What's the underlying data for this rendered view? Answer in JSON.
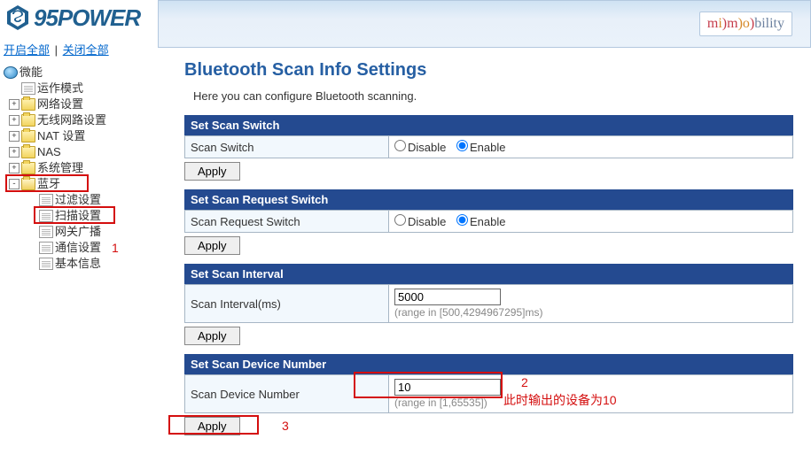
{
  "brand": {
    "name": "95POWER",
    "mimo_m": "m",
    "mimo_i": "i",
    "mimo_paren": ")",
    "mimo_m2": "m",
    "mimo_paren2": ")",
    "mimo_o": "o",
    "mimo_paren3": ")",
    "mimo_tail": "bility"
  },
  "links": {
    "open_all": "开启全部",
    "close_all": "关闭全部"
  },
  "tree": {
    "root": "微能",
    "items": [
      "运作模式",
      "网络设置",
      "无线网路设置",
      "NAT 设置",
      "NAS",
      "系统管理"
    ],
    "bt": "蓝牙",
    "bt_children": [
      "过滤设置",
      "扫描设置",
      "网关广播",
      "通信设置",
      "基本信息"
    ]
  },
  "page": {
    "title": "Bluetooth Scan Info Settings",
    "desc": "Here you can configure Bluetooth scanning."
  },
  "sections": {
    "s1": {
      "head": "Set Scan Switch",
      "label": "Scan Switch",
      "opt_disable": "Disable",
      "opt_enable": "Enable",
      "apply": "Apply"
    },
    "s2": {
      "head": "Set Scan Request Switch",
      "label": "Scan Request Switch",
      "opt_disable": "Disable",
      "opt_enable": "Enable",
      "apply": "Apply"
    },
    "s3": {
      "head": "Set Scan Interval",
      "label": "Scan Interval(ms)",
      "value": "5000",
      "hint": "(range in [500,4294967295]ms)",
      "apply": "Apply"
    },
    "s4": {
      "head": "Set Scan Device Number",
      "label": "Scan Device Number",
      "value": "10",
      "hint": "(range in [1,65535])",
      "apply": "Apply"
    }
  },
  "annot": {
    "a1": "1",
    "a2": "2",
    "a3": "3",
    "note": "此时输出的设备为10"
  }
}
